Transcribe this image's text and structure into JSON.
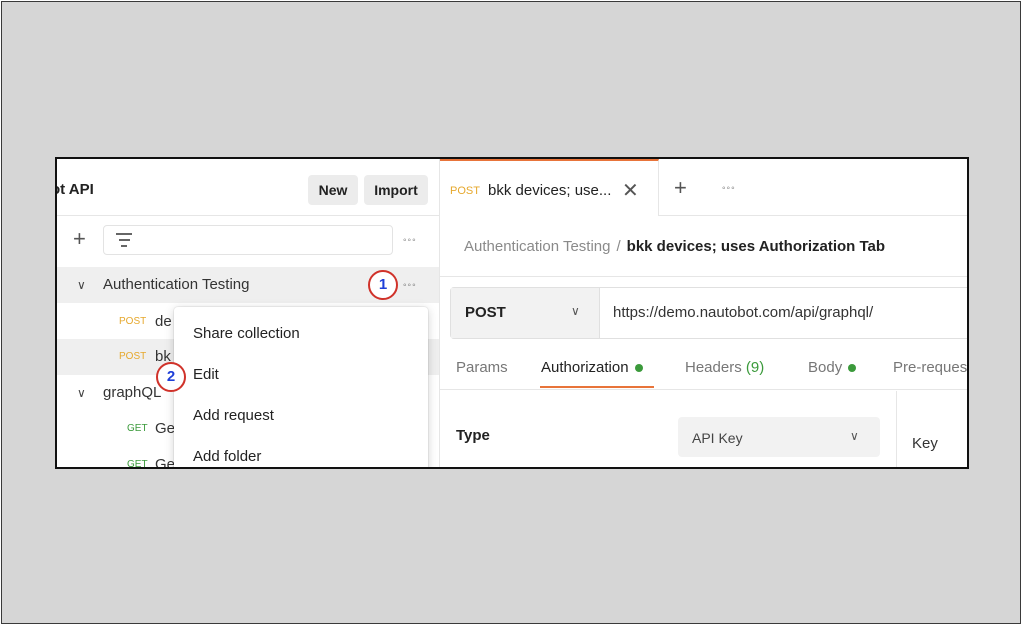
{
  "sidebar": {
    "workspace_title": "ot API",
    "new_label": "New",
    "import_label": "Import",
    "plus_glyph": "+",
    "more_glyph": "◦◦◦",
    "collections": [
      {
        "name": "Authentication Testing",
        "chevron": "∨",
        "requests": [
          {
            "method": "POST",
            "name": "de"
          },
          {
            "method": "POST",
            "name": "bk"
          }
        ]
      },
      {
        "name": "graphQL",
        "chevron": "∨",
        "requests": [
          {
            "method": "GET",
            "name": "Ge"
          },
          {
            "method": "GET",
            "name": "Ge"
          }
        ]
      }
    ]
  },
  "context_menu": {
    "items": [
      "Share collection",
      "Edit",
      "Add request",
      "Add folder"
    ]
  },
  "badges": {
    "one": "1",
    "two": "2"
  },
  "tabs": {
    "active": {
      "method": "POST",
      "title": "bkk devices; use...",
      "close_glyph": "✕"
    },
    "plus_glyph": "+",
    "more_glyph": "◦◦◦"
  },
  "breadcrumb": {
    "parent": "Authentication Testing",
    "separator": "/",
    "current": "bkk devices; uses Authorization Tab"
  },
  "request": {
    "method": "POST",
    "chevron": "∨",
    "url": "https://demo.nautobot.com/api/graphql/"
  },
  "request_tabs": {
    "params": "Params",
    "authorization": "Authorization",
    "headers": "Headers",
    "headers_count": "(9)",
    "body": "Body",
    "prerequest": "Pre-reques"
  },
  "auth": {
    "type_label": "Type",
    "type_value": "API Key",
    "chevron": "∨",
    "key_label": "Key"
  },
  "colors": {
    "accent": "#e8743a",
    "post": "#e6a82d",
    "get": "#3b9a3b",
    "badge_ring": "#d0322a",
    "badge_text": "#1f3fd8"
  }
}
